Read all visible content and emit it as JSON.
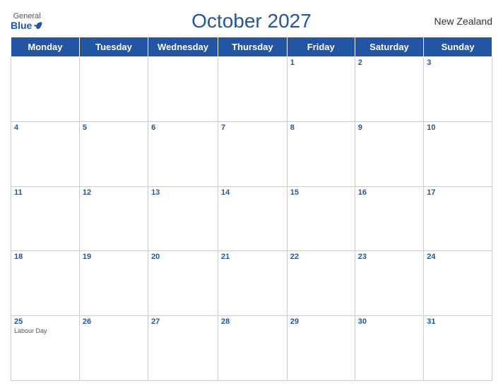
{
  "header": {
    "logo_general": "General",
    "logo_blue": "Blue",
    "title": "October 2027",
    "country": "New Zealand"
  },
  "days_of_week": [
    "Monday",
    "Tuesday",
    "Wednesday",
    "Thursday",
    "Friday",
    "Saturday",
    "Sunday"
  ],
  "weeks": [
    [
      {
        "num": "",
        "holiday": ""
      },
      {
        "num": "",
        "holiday": ""
      },
      {
        "num": "",
        "holiday": ""
      },
      {
        "num": "",
        "holiday": ""
      },
      {
        "num": "1",
        "holiday": ""
      },
      {
        "num": "2",
        "holiday": ""
      },
      {
        "num": "3",
        "holiday": ""
      }
    ],
    [
      {
        "num": "4",
        "holiday": ""
      },
      {
        "num": "5",
        "holiday": ""
      },
      {
        "num": "6",
        "holiday": ""
      },
      {
        "num": "7",
        "holiday": ""
      },
      {
        "num": "8",
        "holiday": ""
      },
      {
        "num": "9",
        "holiday": ""
      },
      {
        "num": "10",
        "holiday": ""
      }
    ],
    [
      {
        "num": "11",
        "holiday": ""
      },
      {
        "num": "12",
        "holiday": ""
      },
      {
        "num": "13",
        "holiday": ""
      },
      {
        "num": "14",
        "holiday": ""
      },
      {
        "num": "15",
        "holiday": ""
      },
      {
        "num": "16",
        "holiday": ""
      },
      {
        "num": "17",
        "holiday": ""
      }
    ],
    [
      {
        "num": "18",
        "holiday": ""
      },
      {
        "num": "19",
        "holiday": ""
      },
      {
        "num": "20",
        "holiday": ""
      },
      {
        "num": "21",
        "holiday": ""
      },
      {
        "num": "22",
        "holiday": ""
      },
      {
        "num": "23",
        "holiday": ""
      },
      {
        "num": "24",
        "holiday": ""
      }
    ],
    [
      {
        "num": "25",
        "holiday": "Labour Day"
      },
      {
        "num": "26",
        "holiday": ""
      },
      {
        "num": "27",
        "holiday": ""
      },
      {
        "num": "28",
        "holiday": ""
      },
      {
        "num": "29",
        "holiday": ""
      },
      {
        "num": "30",
        "holiday": ""
      },
      {
        "num": "31",
        "holiday": ""
      }
    ]
  ]
}
